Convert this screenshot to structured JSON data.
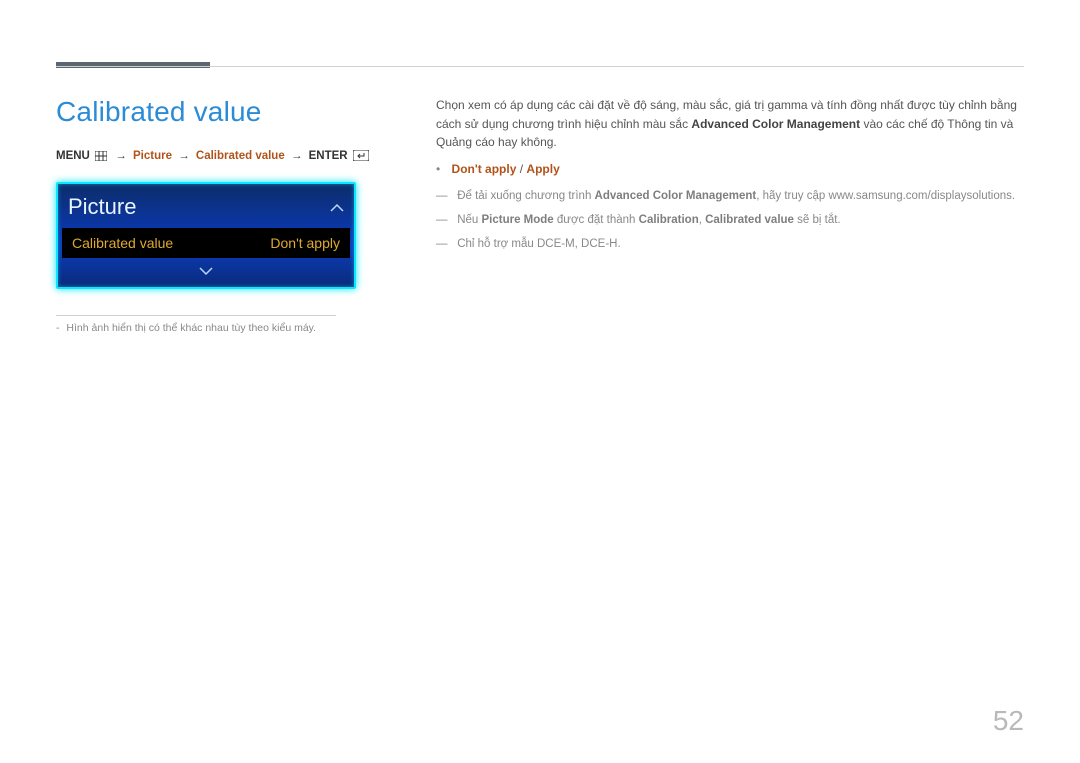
{
  "header": {
    "title": "Calibrated value"
  },
  "breadcrumb": {
    "menu": "MENU",
    "picture": "Picture",
    "calibrated": "Calibrated value",
    "enter": "ENTER",
    "sep": "→"
  },
  "osd": {
    "title": "Picture",
    "row_label": "Calibrated value",
    "row_value": "Don't apply"
  },
  "left_footnote": "Hình ảnh hiển thị có thể khác nhau tùy theo kiểu máy.",
  "right": {
    "para_pre": "Chọn xem có áp dụng các cài đặt về độ sáng, màu sắc, giá trị gamma và tính đồng nhất được tùy chỉnh bằng cách sử dụng chương trình hiệu chỉnh màu sắc ",
    "para_strong": "Advanced Color Management",
    "para_post": " vào các chế độ Thông tin và Quảng cáo hay không.",
    "option_a": "Don't apply",
    "option_sep": " / ",
    "option_b": "Apply",
    "note1_pre": "Để tải xuống chương trình ",
    "note1_strong": "Advanced Color Management",
    "note1_post": ", hãy truy cập www.samsung.com/displaysolutions.",
    "note2_pre": "Nếu ",
    "note2_s1": "Picture Mode",
    "note2_mid": " được đặt thành ",
    "note2_s2": "Calibration",
    "note2_comma": ", ",
    "note2_s3": "Calibrated value",
    "note2_post": " sẽ bị tắt.",
    "note3": "Chỉ hỗ trợ mẫu DCE-M, DCE-H."
  },
  "page_number": "52"
}
